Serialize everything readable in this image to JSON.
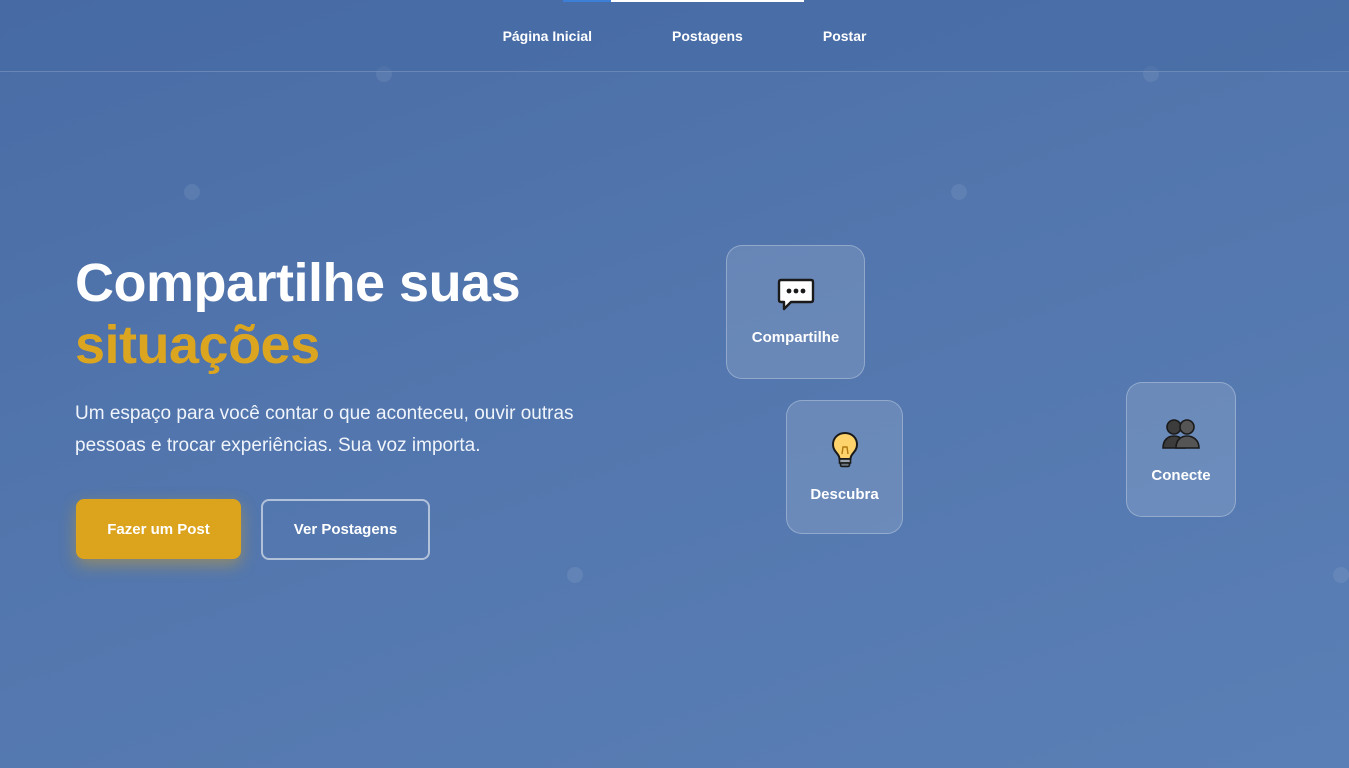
{
  "nav": {
    "links": [
      {
        "label": "Página Inicial"
      },
      {
        "label": "Postagens"
      },
      {
        "label": "Postar"
      }
    ]
  },
  "hero": {
    "title_line1": "Compartilhe suas",
    "title_line2": "situações",
    "subtitle": "Um espaço para você contar o que aconteceu, ouvir outras pessoas e trocar experiências. Sua voz importa.",
    "primary_button": "Fazer um Post",
    "secondary_button": "Ver Postagens"
  },
  "cards": [
    {
      "label": "Compartilhe",
      "icon": "speech-bubble-icon"
    },
    {
      "label": "Descubra",
      "icon": "lightbulb-icon"
    },
    {
      "label": "Conecte",
      "icon": "people-icon"
    }
  ],
  "colors": {
    "accent": "#dca520",
    "background": "#5276ad",
    "nav_active": "#3d7fd6"
  }
}
